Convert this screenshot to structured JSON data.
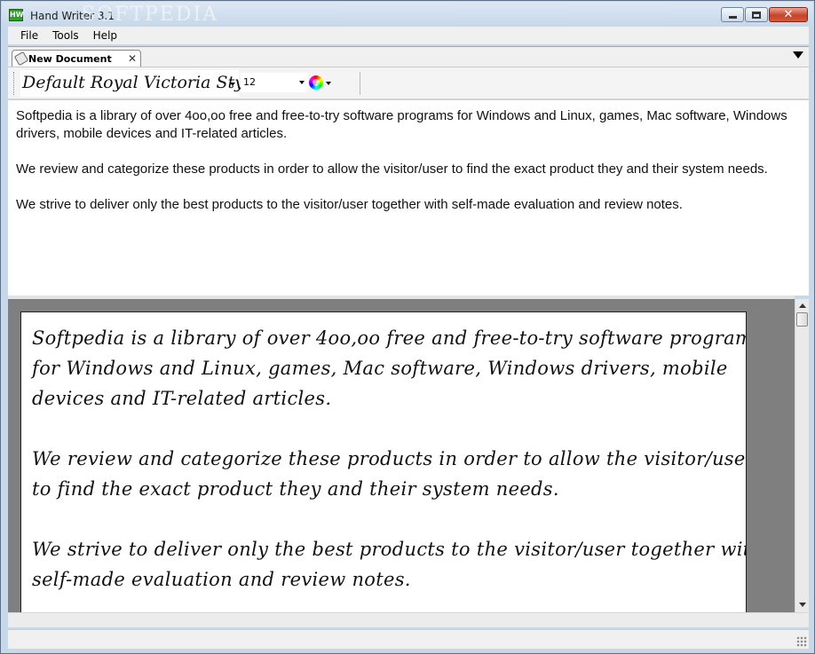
{
  "window": {
    "title": "Hand Writer 3.1",
    "watermark": "SOFTPEDIA",
    "app_icon_text": "HW"
  },
  "menu": [
    "File",
    "Tools",
    "Help"
  ],
  "tabs": [
    {
      "label": "New Document",
      "close": "✕"
    }
  ],
  "toolbar": {
    "font": "Default Royal Victoria Style",
    "size": "12"
  },
  "editor": {
    "paragraphs": [
      "Softpedia is a library of over 4oo,oo free and free-to-try software programs for Windows and Linux, games, Mac software, Windows drivers, mobile devices and IT-related articles.",
      "We review and categorize these products in order to allow the visitor/user to find the exact product they and their system needs.",
      "We strive to deliver only the best products to the visitor/user together with self-made evaluation and review notes."
    ]
  },
  "preview": {
    "paragraphs": [
      "Softpedia is a library of over 4oo,oo free and free-to-try software programs for Windows and Linux, games, Mac software, Windows drivers, mobile devices and IT-related articles.",
      "We review and categorize these products in order to allow the visitor/user to find the exact product they and their system needs.",
      "We strive to deliver only the best products to the visitor/user together with self-made evaluation and review notes."
    ]
  }
}
